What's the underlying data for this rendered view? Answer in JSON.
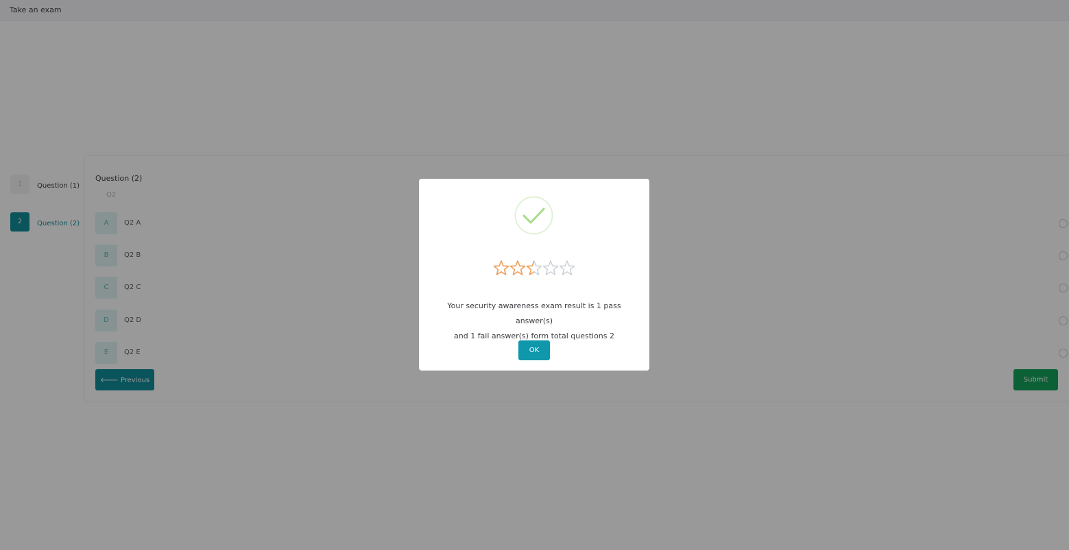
{
  "header": {
    "title": "Take an exam"
  },
  "steps": [
    {
      "num": "1",
      "label": "Question (1)",
      "active": false
    },
    {
      "num": "2",
      "label": "Question (2)",
      "active": true
    }
  ],
  "question": {
    "title": "Question (2)",
    "text": "Q2",
    "options": [
      {
        "letter": "A",
        "text": "Q2 A"
      },
      {
        "letter": "B",
        "text": "Q2 B"
      },
      {
        "letter": "C",
        "text": "Q2 C"
      },
      {
        "letter": "D",
        "text": "Q2 D"
      },
      {
        "letter": "E",
        "text": "Q2 E"
      }
    ]
  },
  "buttons": {
    "previous": "🡐 Previous",
    "submit": "Submit"
  },
  "modal": {
    "icon": "check-circle-icon",
    "rating": {
      "value": 2.5,
      "max": 5
    },
    "message_line1": "Your security awareness exam result is 1 pass answer(s)",
    "message_line2": "and 1 fail answer(s) form total questions 2",
    "ok_label": "OK"
  },
  "colors": {
    "primary": "#128d99",
    "submit": "#14a05a",
    "ok": "#0f97ac",
    "star_filled": "#f0a05a",
    "star_empty": "#c9cdd2",
    "check": "#a5dc86"
  }
}
